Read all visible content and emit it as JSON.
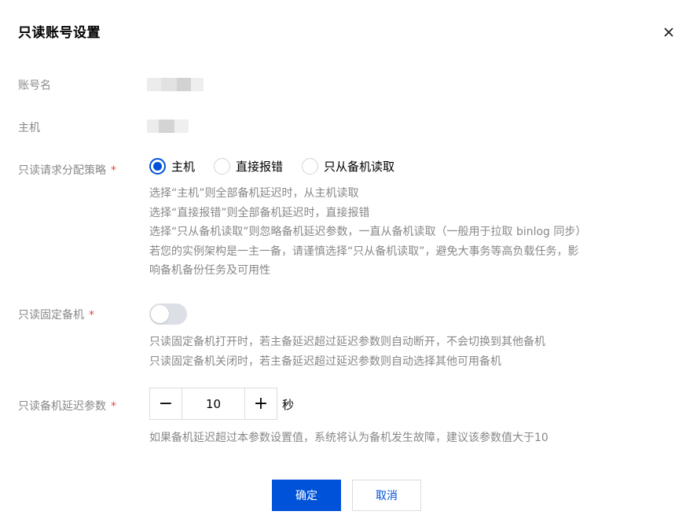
{
  "dialog": {
    "title": "只读账号设置",
    "close_icon": "close-icon"
  },
  "fields": {
    "account_name": {
      "label": "账号名"
    },
    "host": {
      "label": "主机"
    },
    "strategy": {
      "label": "只读请求分配策略",
      "required_mark": "*",
      "options": [
        {
          "label": "主机",
          "checked": true
        },
        {
          "label": "直接报错",
          "checked": false
        },
        {
          "label": "只从备机读取",
          "checked": false
        }
      ],
      "help": [
        "选择“主机”则全部备机延迟时，从主机读取",
        "选择“直接报错”则全部备机延迟时，直接报错",
        "选择“只从备机读取”则忽略备机延迟参数，一直从备机读取（一般用于拉取 binlog 同步）",
        "若您的实例架构是一主一备，请谨慎选择“只从备机读取”，避免大事务等高负载任务，影",
        "响备机备份任务及可用性"
      ]
    },
    "fixed_standby": {
      "label": "只读固定备机",
      "required_mark": "*",
      "enabled": false,
      "help": [
        "只读固定备机打开时，若主备延迟超过延迟参数则自动断开，不会切换到其他备机",
        "只读固定备机关闭时，若主备延迟超过延迟参数则自动选择其他可用备机"
      ]
    },
    "delay": {
      "label": "只读备机延迟参数",
      "required_mark": "*",
      "value": "10",
      "minus": "−",
      "plus": "+",
      "unit": "秒",
      "help": "如果备机延迟超过本参数设置值，系统将认为备机发生故障，建议该参数值大于10"
    }
  },
  "footer": {
    "confirm_label": "确定",
    "cancel_label": "取消"
  },
  "colors": {
    "accent": "#0052d9",
    "required": "#e54545",
    "muted_text": "#888888"
  }
}
